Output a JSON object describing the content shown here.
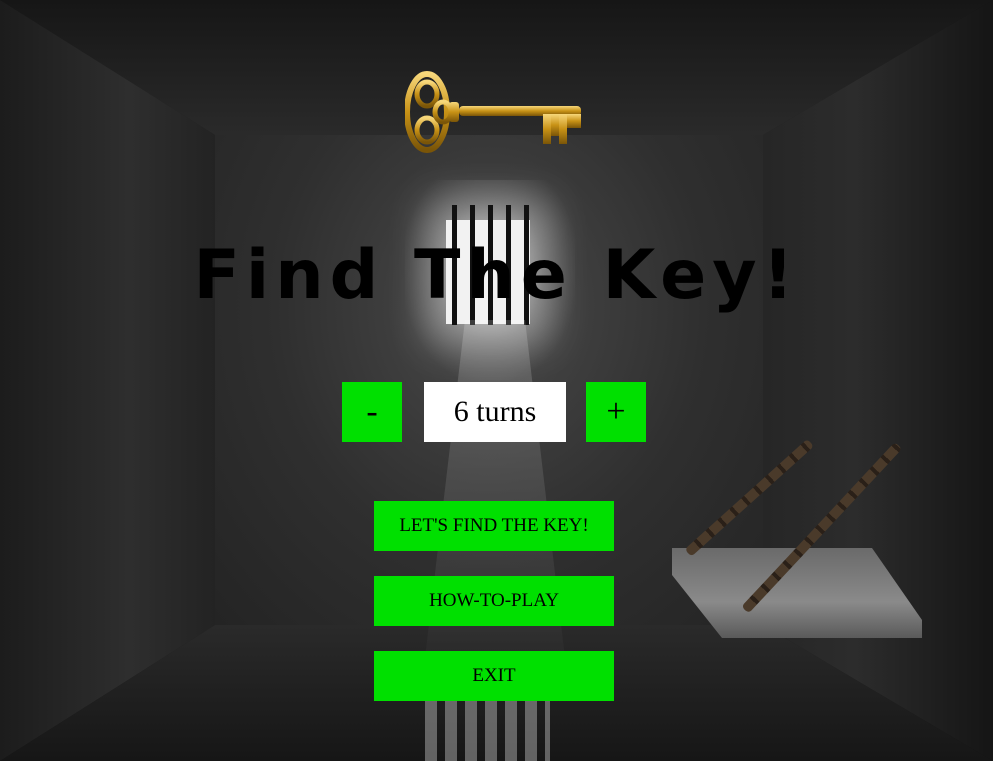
{
  "title": "Find The Key!",
  "turns": {
    "decrement_label": "-",
    "display": "6 turns",
    "increment_label": "+"
  },
  "menu": {
    "start_label": "LET'S FIND THE KEY!",
    "how_to_play_label": "HOW-TO-PLAY",
    "exit_label": "EXIT"
  },
  "icons": {
    "key": "key-icon"
  },
  "colors": {
    "button_green": "#00e000",
    "display_white": "#ffffff",
    "title_black": "#000000"
  }
}
